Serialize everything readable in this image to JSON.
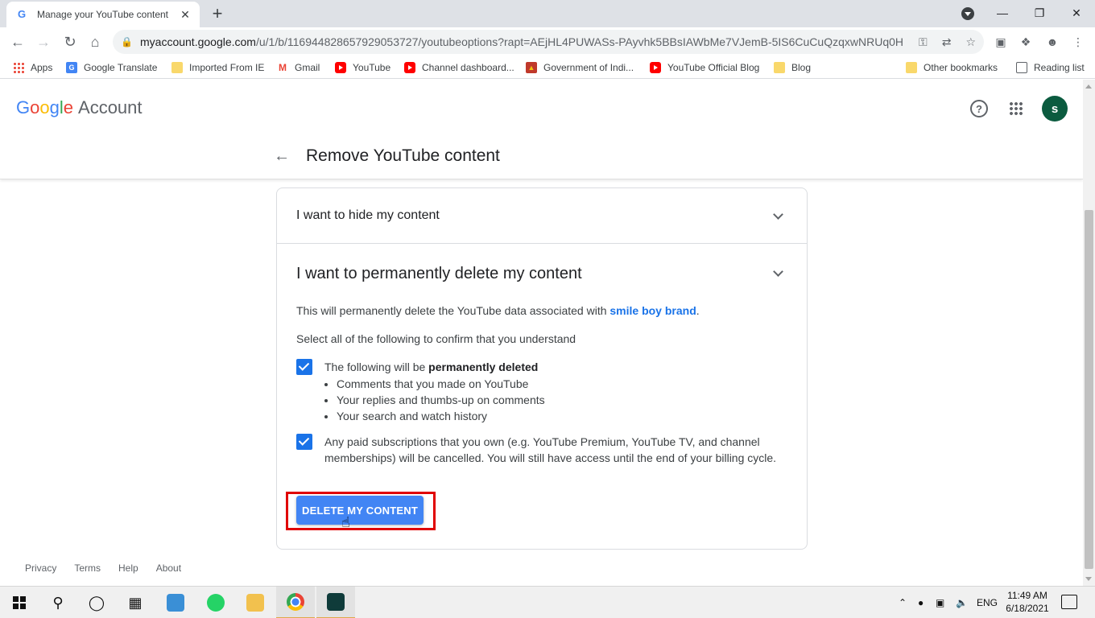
{
  "browser": {
    "tab_title": "Manage your YouTube content",
    "tab_close": "✕",
    "new_tab": "+",
    "url_host": "myaccount.google.com",
    "url_path": "/u/1/b/116944828657929053727/youtubeoptions?rapt=AEjHL4PUWASs-PAyvhk5BBsIAWbMe7VJemB-5IS6CuCuQzqxwNRUq0H..."
  },
  "bookmarks": [
    {
      "label": "Apps"
    },
    {
      "label": "Google Translate"
    },
    {
      "label": "Imported From IE"
    },
    {
      "label": "Gmail"
    },
    {
      "label": "YouTube"
    },
    {
      "label": "Channel dashboard..."
    },
    {
      "label": "Government of Indi..."
    },
    {
      "label": "YouTube Official Blog"
    },
    {
      "label": "Blog"
    },
    {
      "label": "Other bookmarks"
    },
    {
      "label": "Reading list"
    }
  ],
  "header": {
    "logo_letters": [
      "G",
      "o",
      "o",
      "g",
      "l",
      "e"
    ],
    "logo_suffix": "Account",
    "help_glyph": "?",
    "avatar_initial": "s"
  },
  "page": {
    "title": "Remove YouTube content",
    "section_hide": "I want to hide my content",
    "section_delete": "I want to permanently delete my content",
    "desc_prefix": "This will permanently delete the YouTube data associated with ",
    "desc_account": "smile boy brand",
    "desc_suffix": ".",
    "confirm_text": "Select all of the following to confirm that you understand",
    "item1_prefix": "The following will be ",
    "item1_bold": "permanently deleted",
    "item1_bullets": [
      "Comments that you made on YouTube",
      "Your replies and thumbs-up on comments",
      "Your search and watch history"
    ],
    "item2_text": "Any paid subscriptions that you own (e.g. YouTube Premium, YouTube TV, and channel memberships) will be cancelled. You will still have access until the end of your billing cycle.",
    "delete_button": "DELETE MY CONTENT"
  },
  "footer": {
    "links": [
      "Privacy",
      "Terms",
      "Help",
      "About"
    ]
  },
  "taskbar": {
    "language": "ENG",
    "time": "11:49 AM",
    "date": "6/18/2021"
  },
  "colors": {
    "accent": "#1a73e8",
    "button": "#4285f4",
    "highlight_box": "#e00000",
    "avatar": "#0b5b3f"
  }
}
